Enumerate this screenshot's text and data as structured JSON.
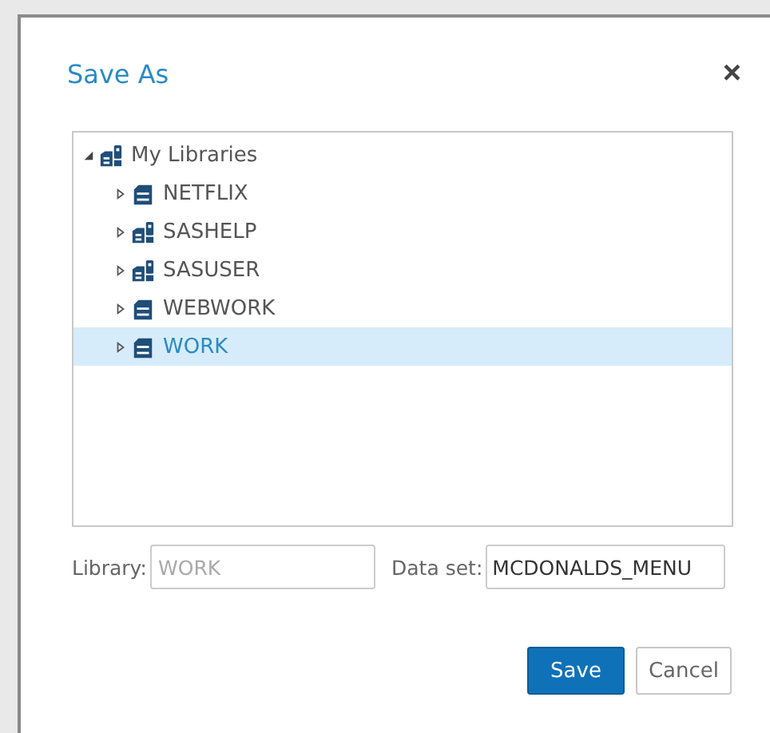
{
  "dialog": {
    "title": "Save As",
    "close": "×"
  },
  "tree": {
    "label": "My Libraries",
    "kind": "stack",
    "expanded": true,
    "selected": false,
    "children": [
      {
        "label": "NETFLIX",
        "kind": "cabinet",
        "expanded": false,
        "selected": false
      },
      {
        "label": "SASHELP",
        "kind": "stack",
        "expanded": false,
        "selected": false
      },
      {
        "label": "SASUSER",
        "kind": "stack",
        "expanded": false,
        "selected": false
      },
      {
        "label": "WEBWORK",
        "kind": "cabinet",
        "expanded": false,
        "selected": false
      },
      {
        "label": "WORK",
        "kind": "cabinet",
        "expanded": false,
        "selected": true
      }
    ]
  },
  "library": {
    "label": "Library:",
    "value": "WORK",
    "disabled": true
  },
  "dataset": {
    "label": "Data set:",
    "value": "MCDONALDS_MENU",
    "disabled": false
  },
  "buttons": [
    {
      "label": "Save",
      "kind": "primary"
    },
    {
      "label": "Cancel",
      "kind": "secondary"
    }
  ]
}
